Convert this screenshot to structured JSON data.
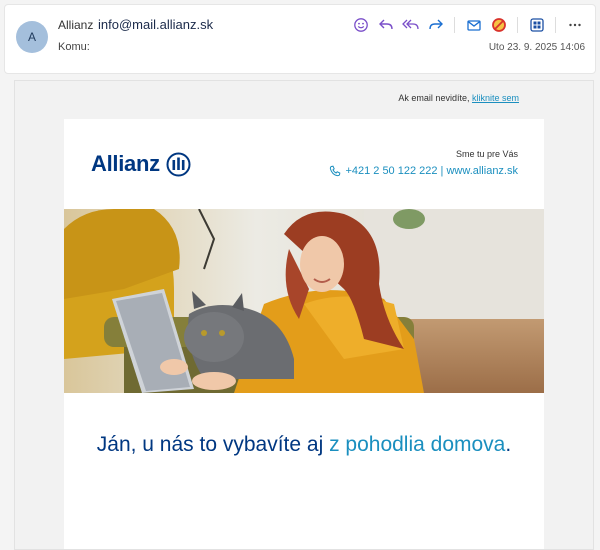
{
  "header": {
    "avatar_initial": "A",
    "sender_name": "Allianz",
    "sender_email": "info@mail.allianz.sk",
    "to_label": "Komu:",
    "date": "Uto 23. 9. 2025 14:06",
    "toolbar": [
      "emoji-icon",
      "reply-icon",
      "reply-all-icon",
      "forward-icon",
      "mail-icon",
      "block-icon",
      "apps-icon",
      "more-icon"
    ]
  },
  "email": {
    "view_online_text": "Ak email nevidíte,",
    "view_online_link": "kliknite sem",
    "logo_text": "Allianz",
    "contact_heading": "Sme tu pre Vás",
    "contact_line": "+421 2 50 122 222 | www.allianz.sk",
    "headline_part1": "Ján, u nás to vybavíte aj ",
    "headline_accent": "z pohodlia domova",
    "headline_end": "."
  },
  "colors": {
    "brand_blue": "#003781",
    "accent_blue": "#1b8fbf",
    "avatar_bg": "#a4bfdc"
  }
}
